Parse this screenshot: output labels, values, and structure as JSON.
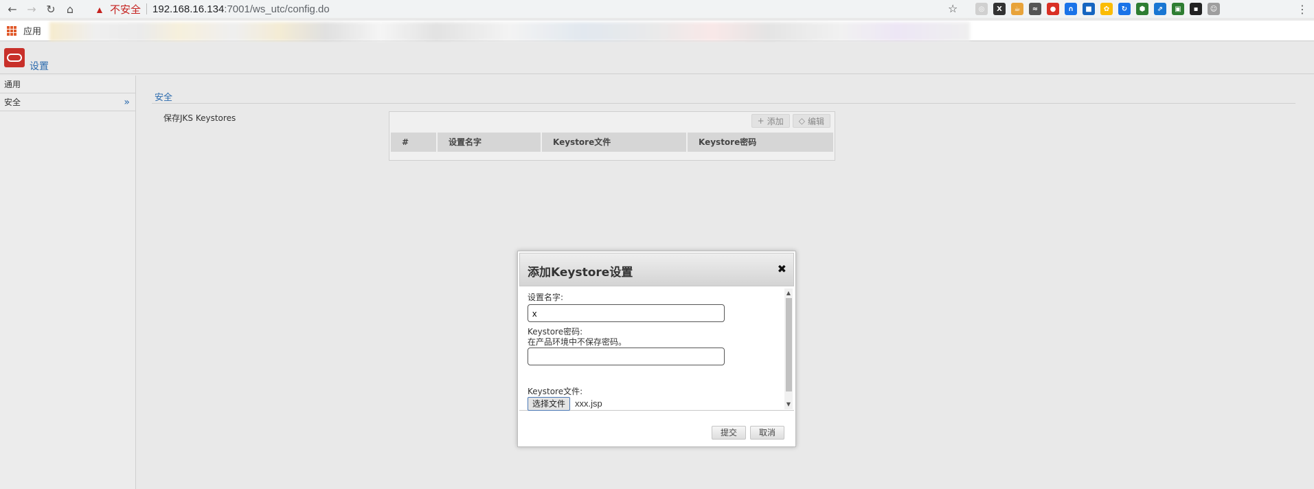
{
  "browser": {
    "security_label": "不安全",
    "url_host": "192.168.16.134",
    "url_rest": ":7001/ws_utc/config.do",
    "apps_label": "应用",
    "extensions": [
      {
        "icon": "ext-mixed-icon",
        "color": "#d0d0d0",
        "glyph": "◎"
      },
      {
        "icon": "ext-x-icon",
        "color": "#333333",
        "glyph": "X"
      },
      {
        "icon": "ext-java-icon",
        "color": "#e8a33a",
        "glyph": "☕"
      },
      {
        "icon": "ext-graph-icon",
        "color": "#555555",
        "glyph": "≈"
      },
      {
        "icon": "ext-stop-icon",
        "color": "#d93025",
        "glyph": "●"
      },
      {
        "icon": "ext-arch-icon",
        "color": "#1a73e8",
        "glyph": "∩"
      },
      {
        "icon": "ext-blue-icon",
        "color": "#1565c0",
        "glyph": "■"
      },
      {
        "icon": "ext-color-icon",
        "color": "#fbbc04",
        "glyph": "✿"
      },
      {
        "icon": "ext-sync-icon",
        "color": "#1a73e8",
        "glyph": "↻"
      },
      {
        "icon": "ext-shield-icon",
        "color": "#2e7d32",
        "glyph": "⬢"
      },
      {
        "icon": "ext-link-icon",
        "color": "#1976d2",
        "glyph": "⇗"
      },
      {
        "icon": "ext-green-icon",
        "color": "#2e7d32",
        "glyph": "▣"
      },
      {
        "icon": "ext-dark-icon",
        "color": "#222222",
        "glyph": "▪"
      },
      {
        "icon": "profile-avatar-icon",
        "color": "#9e9e9e",
        "glyph": "☺"
      }
    ]
  },
  "app": {
    "title": "设置"
  },
  "sidebar": {
    "items": [
      {
        "label": "通用"
      },
      {
        "label": "安全"
      }
    ]
  },
  "main": {
    "section_title": "安全",
    "keystores_label": "保存JKS Keystores",
    "toolbar": {
      "add_label": "添加",
      "edit_label": "编辑"
    },
    "table": {
      "columns": [
        "#",
        "设置名字",
        "Keystore文件",
        "Keystore密码"
      ]
    }
  },
  "dialog": {
    "title": "添加Keystore设置",
    "name_label": "设置名字:",
    "name_value": "x",
    "password_label": "Keystore密码:",
    "password_hint": "在产品环境中不保存密码。",
    "password_value": "",
    "file_label": "Keystore文件:",
    "file_button": "选择文件",
    "file_name": "xxx.jsp",
    "submit_label": "提交",
    "cancel_label": "取消"
  }
}
